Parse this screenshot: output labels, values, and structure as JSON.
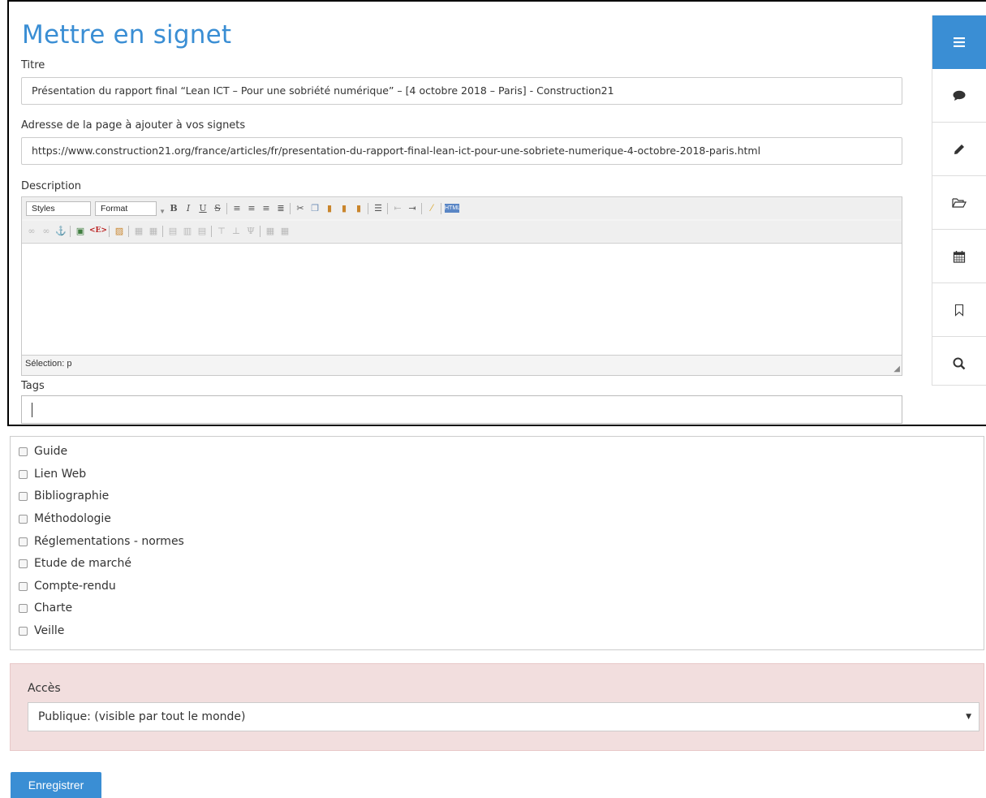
{
  "page": {
    "title": "Mettre en signet",
    "accent_color": "#3a8ed4"
  },
  "form": {
    "title_label": "Titre",
    "title_value": "Présentation du rapport final “Lean ICT – Pour une sobriété numérique” – [4 octobre 2018 – Paris] - Construction21",
    "url_label": "Adresse de la page à ajouter à vos signets",
    "url_value": "https://www.construction21.org/france/articles/fr/presentation-du-rapport-final-lean-ict-pour-une-sobriete-numerique-4-octobre-2018-paris.html",
    "description_label": "Description",
    "tags_label": "Tags",
    "tags_value": ""
  },
  "editor": {
    "styles_select": "Styles",
    "format_select": "Format",
    "status_text": "Sélection: p",
    "toolbar_icons": [
      "bold-icon",
      "italic-icon",
      "underline-icon",
      "strikethrough-icon",
      "align-left-icon",
      "align-center-icon",
      "align-right-icon",
      "justify-icon",
      "cut-icon",
      "copy-icon",
      "paste-icon",
      "paste-text-icon",
      "paste-word-icon",
      "bulleted-list-icon",
      "outdent-icon",
      "indent-icon",
      "cleanup-icon",
      "html-source-icon"
    ],
    "toolbar2_icons": [
      "link-icon",
      "unlink-icon",
      "anchor-icon",
      "insert-image-icon",
      "edit-html-icon",
      "insert-media-icon",
      "table-icon",
      "row-icon",
      "column-icon",
      "merge-cells-icon",
      "split-cells-icon",
      "delete-table-icon"
    ]
  },
  "sidebar": {
    "items": [
      {
        "icon": "menu-icon",
        "active": true
      },
      {
        "icon": "comment-icon"
      },
      {
        "icon": "pencil-icon"
      },
      {
        "icon": "folder-icon"
      },
      {
        "icon": "calendar-icon"
      },
      {
        "icon": "bookmark-icon"
      },
      {
        "icon": "search-icon"
      }
    ]
  },
  "categories": [
    {
      "label": "Guide",
      "checked": false
    },
    {
      "label": "Lien Web",
      "checked": false
    },
    {
      "label": "Bibliographie",
      "checked": false
    },
    {
      "label": "Méthodologie",
      "checked": false
    },
    {
      "label": "Réglementations - normes",
      "checked": false
    },
    {
      "label": "Etude de marché",
      "checked": false
    },
    {
      "label": "Compte-rendu",
      "checked": false
    },
    {
      "label": "Charte",
      "checked": false
    },
    {
      "label": "Veille",
      "checked": false
    }
  ],
  "access": {
    "label": "Accès",
    "selected": "Publique: (visible par tout le monde)",
    "panel_color": "#f2dede"
  },
  "actions": {
    "save_label": "Enregistrer"
  }
}
